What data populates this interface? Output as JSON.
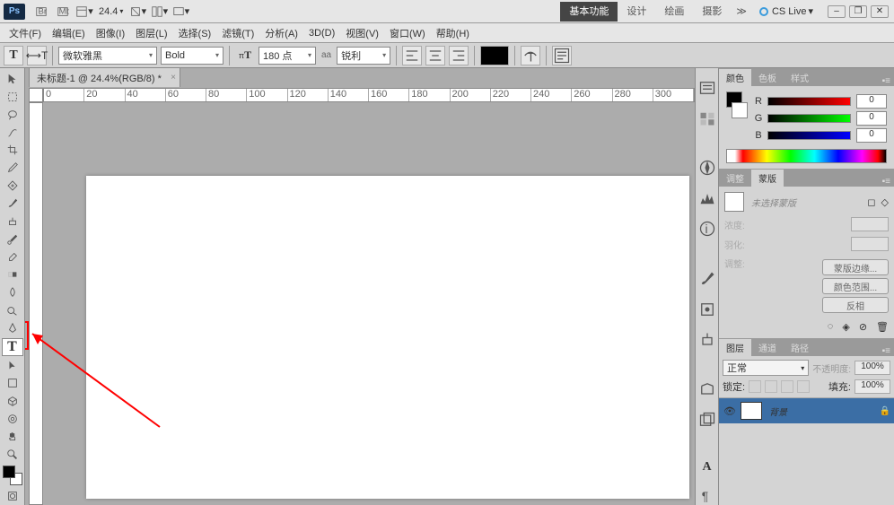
{
  "app": {
    "logo": "Ps",
    "zoom_display": "24.4",
    "cslive": "CS Live"
  },
  "workspaces": {
    "essential": "基本功能",
    "design": "设计",
    "painting": "绘画",
    "photo": "摄影"
  },
  "menus": {
    "file": "文件(F)",
    "edit": "编辑(E)",
    "image": "图像(I)",
    "layer": "图层(L)",
    "select": "选择(S)",
    "filter": "滤镜(T)",
    "analysis": "分析(A)",
    "3d": "3D(D)",
    "view": "视图(V)",
    "window": "窗口(W)",
    "help": "帮助(H)"
  },
  "options": {
    "font_family": "微软雅黑",
    "font_weight": "Bold",
    "font_size": "180 点",
    "aa_label": "aa",
    "aa_mode": "锐利"
  },
  "doc_tab": "未标题-1 @ 24.4%(RGB/8) *",
  "ruler_ticks": [
    "0",
    "20",
    "40",
    "60",
    "80",
    "100",
    "120",
    "140",
    "160",
    "180",
    "200",
    "220",
    "240",
    "260",
    "280",
    "300"
  ],
  "color_panel": {
    "tabs": {
      "color": "颜色",
      "swatches": "色板",
      "styles": "样式"
    },
    "r_label": "R",
    "g_label": "G",
    "b_label": "B",
    "r": "0",
    "g": "0",
    "b": "0"
  },
  "mask_panel": {
    "tabs": {
      "adjust": "调整",
      "mask": "蒙版"
    },
    "unselected": "未选择蒙版",
    "density": "浓度:",
    "feather": "羽化:",
    "refine": "调整:",
    "btn_edge": "蒙版边缘...",
    "btn_range": "颜色范围...",
    "btn_invert": "反相"
  },
  "layers_panel": {
    "tabs": {
      "layers": "图层",
      "channels": "通道",
      "paths": "路径"
    },
    "blend": "正常",
    "opacity_lbl": "不透明度:",
    "opacity": "100%",
    "lock_lbl": "锁定:",
    "fill_lbl": "填充:",
    "fill": "100%",
    "bg_layer": "背景"
  }
}
